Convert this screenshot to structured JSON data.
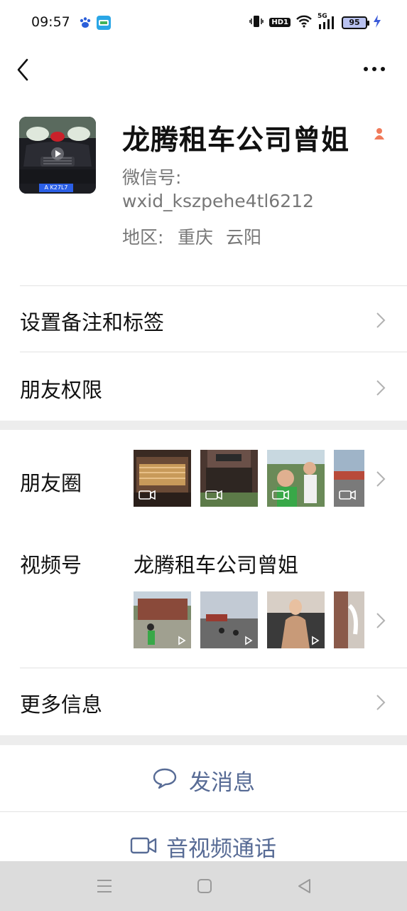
{
  "status_bar": {
    "time": "09:57",
    "network": "5G",
    "hd_label": "HD1",
    "battery": "95",
    "icons": [
      "baidu-paw-icon",
      "map-app-icon",
      "vibrate-icon",
      "wifi-icon",
      "signal-icon",
      "charging-icon"
    ]
  },
  "nav": {
    "back_icon": "chevron-left-icon",
    "more_icon": "more-dots-icon"
  },
  "profile": {
    "name": "龙腾租车公司曾姐",
    "wechat_id_label": "微信号:",
    "wechat_id": "wxid_kszpehe4tl6212",
    "region_label": "地区:",
    "region": "重庆 云阳",
    "plate_text": "A K27L7",
    "gender_icon": "female-person-icon"
  },
  "menu": {
    "remark_tags": "设置备注和标签",
    "friend_permissions": "朋友权限",
    "moments": "朋友圈",
    "channels": "视频号",
    "channel_name": "龙腾租车公司曾姐",
    "more_info": "更多信息"
  },
  "actions": {
    "send_message": "发消息",
    "av_call": "音视频通话"
  },
  "colors": {
    "link_blue": "#576b95",
    "background": "#ededed",
    "panel": "#ffffff",
    "female_icon": "#f07a5a"
  }
}
